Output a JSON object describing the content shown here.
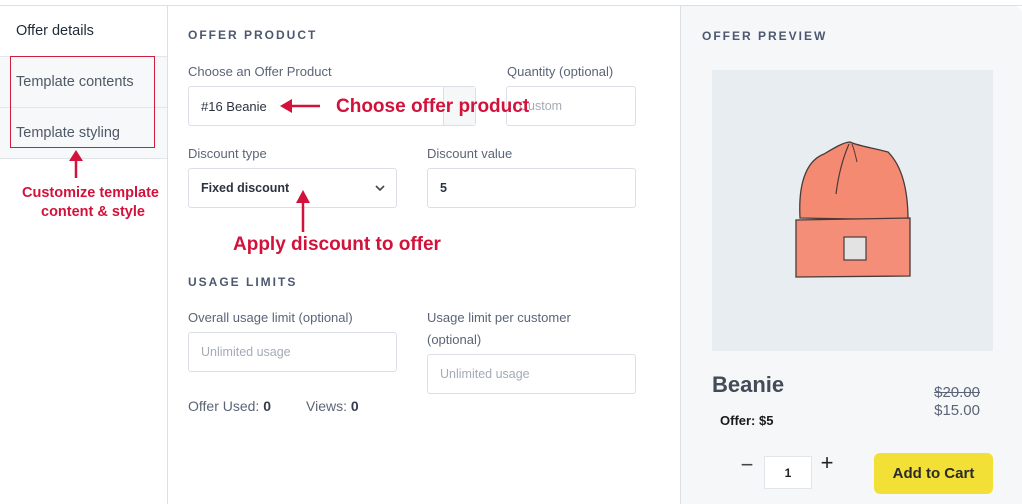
{
  "sidebar": {
    "items": [
      {
        "label": "Offer details",
        "active": true
      },
      {
        "label": "Template contents",
        "active": false
      },
      {
        "label": "Template styling",
        "active": false
      }
    ]
  },
  "form": {
    "offer_product_title": "OFFER PRODUCT",
    "product_label": "Choose an Offer Product",
    "product_value": "#16 Beanie",
    "quantity_label": "Quantity (optional)",
    "quantity_placeholder": "Custom",
    "discount_type_label": "Discount type",
    "discount_type_value": "Fixed discount",
    "discount_value_label": "Discount value",
    "discount_value": "5",
    "usage_limits_title": "USAGE LIMITS",
    "overall_limit_label": "Overall usage limit (optional)",
    "overall_limit_placeholder": "Unlimited usage",
    "per_customer_label_line1": "Usage limit per customer",
    "per_customer_label_line2": "(optional)",
    "per_customer_placeholder": "Unlimited usage",
    "offer_used_label": "Offer Used:",
    "offer_used_value": "0",
    "views_label": "Views:",
    "views_value": "0"
  },
  "preview": {
    "title": "OFFER PREVIEW",
    "product_name": "Beanie",
    "offer_text": "Offer: $5",
    "original_price": "$20.00",
    "offer_price": "$15.00",
    "quantity": "1",
    "minus_label": "−",
    "plus_label": "+",
    "add_to_cart_label": "Add to Cart",
    "accent_color": "#f2e037"
  },
  "annotations": {
    "customize_line1": "Customize template",
    "customize_line2": "content & style",
    "choose_product": "Choose offer product",
    "apply_discount": "Apply discount to offer",
    "color": "#d2123a"
  }
}
